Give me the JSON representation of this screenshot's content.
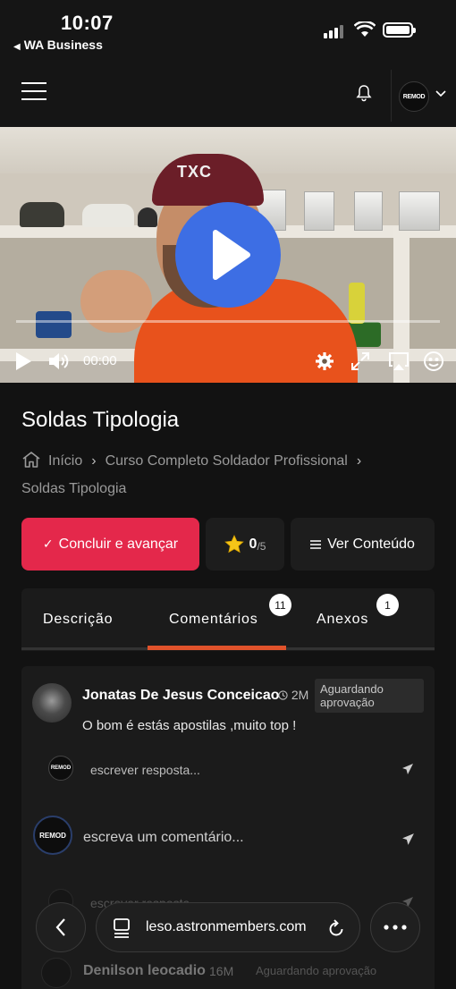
{
  "status_bar": {
    "time": "10:07",
    "back_app": "WA Business"
  },
  "nav": {
    "logo_text": "REMOD"
  },
  "video": {
    "current_time": "00:00",
    "cap_text": "TXC",
    "progress": 0
  },
  "lesson": {
    "title": "Soldas Tipologia",
    "breadcrumb": [
      "Início",
      "Curso Completo Soldador Profissional",
      "Soldas Tipologia"
    ]
  },
  "actions": {
    "complete_label": "Concluir e avançar",
    "rating_value": "0",
    "rating_max": "/5",
    "content_label": "Ver Conteúdo"
  },
  "tabs": [
    {
      "label": "Descrição",
      "badge": ""
    },
    {
      "label": "Comentários",
      "badge": "11"
    },
    {
      "label": "Anexos",
      "badge": "1"
    }
  ],
  "comments": {
    "items": [
      {
        "author": "Jonatas De Jesus Conceicao",
        "time": "2M",
        "status": "Aguardando aprovação",
        "text": "O bom é estás apostilas ,muito top !",
        "reply_placeholder": "escrever resposta..."
      }
    ],
    "new_comment_placeholder": "escreva um comentário...",
    "partial_reply_placeholder": "escrever resposta...",
    "next_author": "Denilson leocadio",
    "next_time": "16M",
    "next_status": "Aguardando aprovação"
  },
  "browser": {
    "url": "leso.astronmembers.com"
  },
  "colors": {
    "primary": "#e4284b",
    "tab_active": "#e0522b",
    "play": "#3d6ee4",
    "background": "#121212"
  }
}
